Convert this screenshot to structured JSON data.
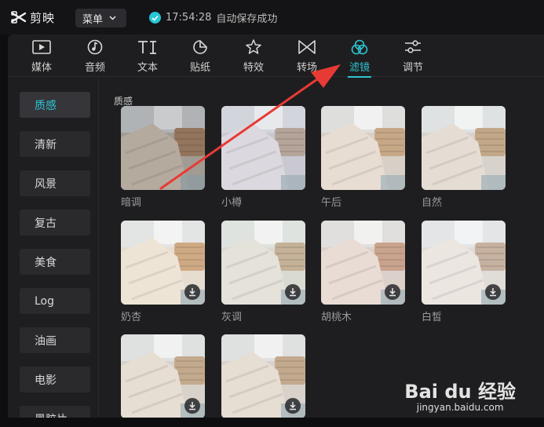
{
  "app": {
    "name": "剪映"
  },
  "menu": {
    "label": "菜单"
  },
  "status": {
    "time": "17:54:28",
    "message": "自动保存成功"
  },
  "tabs": [
    {
      "label": "媒体",
      "icon": "media-icon"
    },
    {
      "label": "音频",
      "icon": "audio-icon"
    },
    {
      "label": "文本",
      "icon": "text-icon"
    },
    {
      "label": "贴纸",
      "icon": "sticker-icon"
    },
    {
      "label": "特效",
      "icon": "effects-icon"
    },
    {
      "label": "转场",
      "icon": "transition-icon"
    },
    {
      "label": "滤镜",
      "icon": "filter-icon",
      "active": true
    },
    {
      "label": "调节",
      "icon": "adjust-icon"
    }
  ],
  "categories": [
    {
      "label": "质感",
      "active": true
    },
    {
      "label": "清新"
    },
    {
      "label": "风景"
    },
    {
      "label": "复古"
    },
    {
      "label": "美食"
    },
    {
      "label": "Log"
    },
    {
      "label": "油画"
    },
    {
      "label": "电影"
    },
    {
      "label": "黑胶片"
    }
  ],
  "section": {
    "title": "质感"
  },
  "filters": [
    {
      "label": "暗调",
      "downloaded": true
    },
    {
      "label": "小樽",
      "downloaded": true
    },
    {
      "label": "午后",
      "downloaded": true
    },
    {
      "label": "自然",
      "downloaded": true
    },
    {
      "label": "奶杏",
      "downloaded": false
    },
    {
      "label": "灰调",
      "downloaded": false
    },
    {
      "label": "胡桃木",
      "downloaded": false
    },
    {
      "label": "白皙",
      "downloaded": false
    },
    {
      "label": "",
      "downloaded": false
    },
    {
      "label": "",
      "downloaded": false
    }
  ],
  "watermark": {
    "main": "Bai du 经验",
    "sub": "jingyan.baidu.com"
  },
  "colors": {
    "accent": "#2fc3d3",
    "annotation_arrow": "#e83a34"
  }
}
